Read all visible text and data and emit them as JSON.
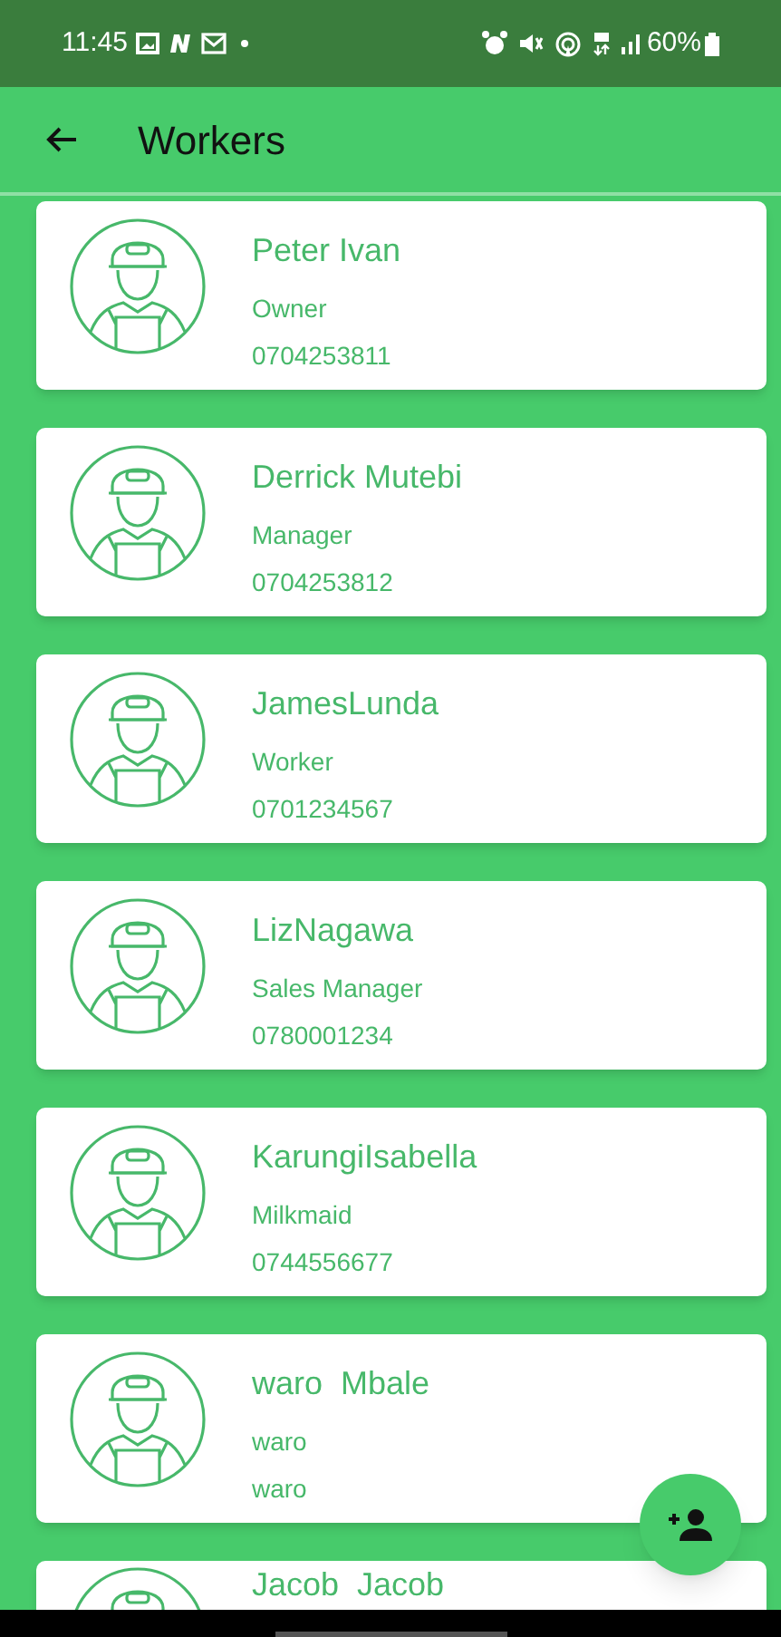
{
  "status_bar": {
    "time": "11:45",
    "battery": "60%"
  },
  "app_bar": {
    "title": "Workers"
  },
  "workers": [
    {
      "name": "Peter Ivan",
      "role": "Owner",
      "phone": "0704253811"
    },
    {
      "name": "Derrick Mutebi",
      "role": "Manager",
      "phone": "0704253812"
    },
    {
      "name": "JamesLunda",
      "role": "Worker",
      "phone": "0701234567"
    },
    {
      "name": "LizNagawa",
      "role": "Sales Manager",
      "phone": "0780001234"
    },
    {
      "name": "KarungiIsabella",
      "role": "Milkmaid",
      "phone": "0744556677"
    },
    {
      "name": "waro  Mbale",
      "role": "waro",
      "phone": "waro"
    },
    {
      "name": "Jacob  Jacob"
    }
  ]
}
